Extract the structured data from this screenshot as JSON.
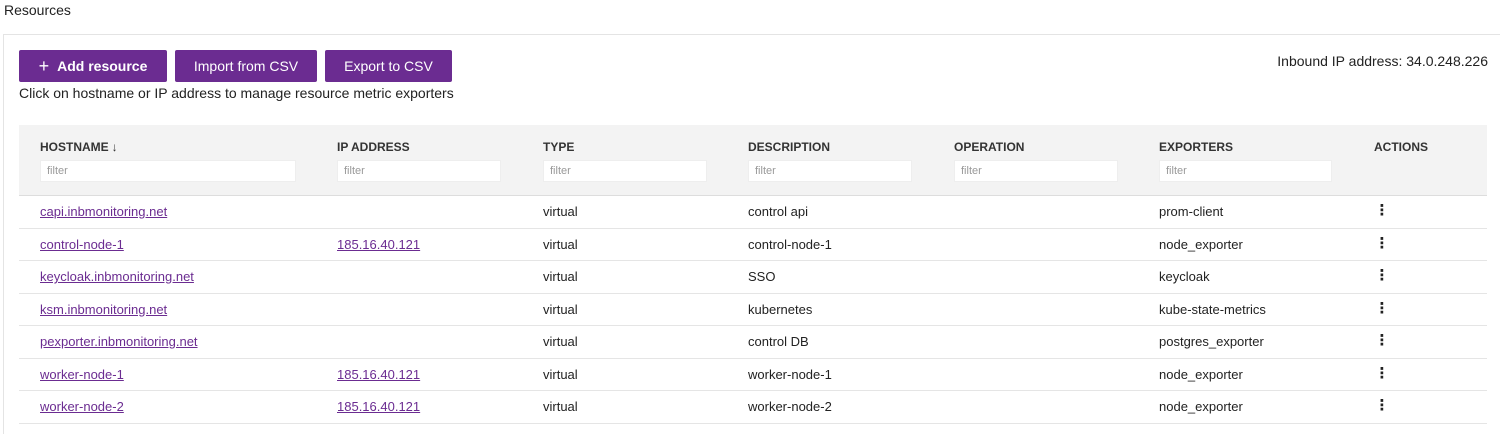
{
  "page": {
    "title": "Resources"
  },
  "toolbar": {
    "add_label": "Add resource",
    "import_label": "Import from CSV",
    "export_label": "Export to CSV"
  },
  "hint": "Click on hostname or IP address to manage resource metric exporters",
  "inbound": "Inbound IP address: 34.0.248.226",
  "table": {
    "headers": {
      "hostname": "HOSTNAME",
      "ip": "IP ADDRESS",
      "type": "TYPE",
      "description": "DESCRIPTION",
      "operation": "OPERATION",
      "exporters": "EXPORTERS",
      "actions": "ACTIONS"
    },
    "filter_placeholder": "filter",
    "rows": [
      {
        "hostname": "capi.inbmonitoring.net",
        "ip": "",
        "type": "virtual",
        "description": "control api",
        "operation": "",
        "exporters": "prom-client"
      },
      {
        "hostname": "control-node-1",
        "ip": "185.16.40.121",
        "type": "virtual",
        "description": "control-node-1",
        "operation": "",
        "exporters": "node_exporter"
      },
      {
        "hostname": "keycloak.inbmonitoring.net",
        "ip": "",
        "type": "virtual",
        "description": "SSO",
        "operation": "",
        "exporters": "keycloak"
      },
      {
        "hostname": "ksm.inbmonitoring.net",
        "ip": "",
        "type": "virtual",
        "description": "kubernetes",
        "operation": "",
        "exporters": "kube-state-metrics"
      },
      {
        "hostname": "pexporter.inbmonitoring.net",
        "ip": "",
        "type": "virtual",
        "description": "control DB",
        "operation": "",
        "exporters": "postgres_exporter"
      },
      {
        "hostname": "worker-node-1",
        "ip": "185.16.40.121",
        "type": "virtual",
        "description": "worker-node-1",
        "operation": "",
        "exporters": "node_exporter"
      },
      {
        "hostname": "worker-node-2",
        "ip": "185.16.40.121",
        "type": "virtual",
        "description": "worker-node-2",
        "operation": "",
        "exporters": "node_exporter"
      }
    ]
  },
  "colors": {
    "accent": "#6b2c91",
    "header_bg": "#f3f3f3"
  },
  "icons": {
    "add": "plus-icon",
    "sort": "arrow-down-icon",
    "actions": "kebab-icon"
  }
}
